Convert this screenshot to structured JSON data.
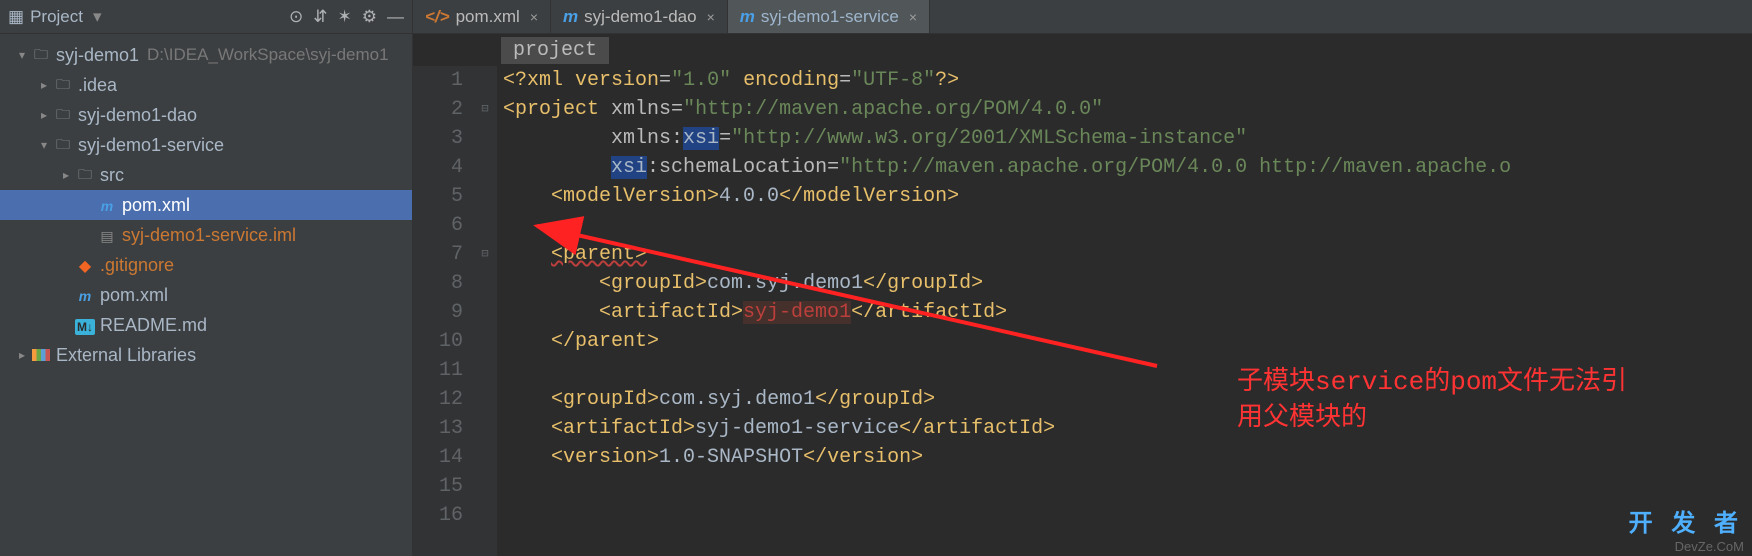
{
  "sidebar": {
    "title": "Project",
    "toolbar_icons": [
      "target-icon",
      "expand-icon",
      "collapse-icon",
      "settings-icon",
      "hide-icon"
    ],
    "tree": [
      {
        "depth": 0,
        "arrow": "expanded",
        "icon": "folder-mod",
        "icon_name": "module-folder-icon",
        "label": "syj-demo1",
        "path": "D:\\IDEA_WorkSpace\\syj-demo1",
        "selected": false
      },
      {
        "depth": 1,
        "arrow": "collapsed",
        "icon": "folder",
        "icon_name": "folder-icon",
        "label": ".idea",
        "selected": false
      },
      {
        "depth": 1,
        "arrow": "collapsed",
        "icon": "folder-mod",
        "icon_name": "module-folder-icon",
        "label": "syj-demo1-dao",
        "selected": false
      },
      {
        "depth": 1,
        "arrow": "expanded",
        "icon": "folder-mod",
        "icon_name": "module-folder-icon",
        "label": "syj-demo1-service",
        "selected": false
      },
      {
        "depth": 2,
        "arrow": "collapsed",
        "icon": "folder",
        "icon_name": "folder-icon",
        "label": "src",
        "selected": false
      },
      {
        "depth": 3,
        "arrow": "none",
        "icon": "maven",
        "icon_name": "maven-file-icon",
        "label": "pom.xml",
        "selected": true
      },
      {
        "depth": 3,
        "arrow": "none",
        "icon": "file",
        "icon_name": "iml-file-icon",
        "label": "syj-demo1-service.iml",
        "warn": true,
        "selected": false
      },
      {
        "depth": 2,
        "arrow": "none",
        "icon": "git",
        "icon_name": "gitignore-icon",
        "label": ".gitignore",
        "warn": true,
        "selected": false
      },
      {
        "depth": 2,
        "arrow": "none",
        "icon": "maven-root",
        "icon_name": "maven-file-icon",
        "label": "pom.xml",
        "selected": false
      },
      {
        "depth": 2,
        "arrow": "none",
        "icon": "md",
        "icon_name": "markdown-icon",
        "label": "README.md",
        "selected": false
      },
      {
        "depth": 0,
        "arrow": "collapsed",
        "icon": "lib",
        "icon_name": "libraries-icon",
        "label": "External Libraries",
        "selected": false
      }
    ]
  },
  "tabs": [
    {
      "icon": "pom",
      "label": "pom.xml",
      "active": false
    },
    {
      "icon": "m",
      "label": "syj-demo1-dao",
      "active": false
    },
    {
      "icon": "m",
      "label": "syj-demo1-service",
      "active": true
    }
  ],
  "breadcrumb": "project",
  "code": {
    "lines": [
      {
        "n": 1,
        "html": "<span class='t-pi'>&lt;?</span><span class='t-tag'>xml version</span><span class='t-attr'>=</span><span class='t-val'>\"1.0\"</span> <span class='t-tag'>encoding</span><span class='t-attr'>=</span><span class='t-val'>\"UTF-8\"</span><span class='t-pi'>?&gt;</span>"
      },
      {
        "n": 2,
        "fold": "-",
        "html": "<span class='t-tag'>&lt;project</span> <span class='t-attr'>xmlns</span><span class='t-attr'>=</span><span class='t-val'>\"http://maven.apache.org/POM/4.0.0\"</span>"
      },
      {
        "n": 3,
        "html": "         <span class='t-attr'>xmlns:</span><span class='t-hl'>xsi</span><span class='t-attr'>=</span><span class='t-val'>\"http://www.w3.org/2001/XMLSchema-instance\"</span>"
      },
      {
        "n": 4,
        "html": "         <span class='t-hl'>xsi</span><span class='t-attr'>:schemaLocation=</span><span class='t-val'>\"http://maven.apache.org/POM/4.0.0 http://maven.apache.o</span>"
      },
      {
        "n": 5,
        "html": "    <span class='t-tag'>&lt;modelVersion&gt;</span><span class='t-text'>4.0.0</span><span class='t-tag'>&lt;/modelVersion&gt;</span>"
      },
      {
        "n": 6,
        "html": ""
      },
      {
        "n": 7,
        "fold": "-",
        "html": "    <span class='t-tag wavy'>&lt;parent&gt;</span>"
      },
      {
        "n": 8,
        "html": "        <span class='t-tag'>&lt;groupId&gt;</span><span class='t-text'>com.syj.demo1</span><span class='t-tag'>&lt;/groupId&gt;</span>"
      },
      {
        "n": 9,
        "html": "        <span class='t-tag'>&lt;artifactId&gt;</span><span class='error-underline'>syj-demo1</span><span class='t-tag'>&lt;/artifactId&gt;</span>"
      },
      {
        "n": 10,
        "html": "    <span class='t-tag'>&lt;/parent&gt;</span>"
      },
      {
        "n": 11,
        "html": ""
      },
      {
        "n": 12,
        "html": "    <span class='t-tag'>&lt;groupId&gt;</span><span class='t-text'>com.syj.demo1</span><span class='t-tag'>&lt;/groupId&gt;</span>"
      },
      {
        "n": 13,
        "html": "    <span class='t-tag'>&lt;artifactId&gt;</span><span class='t-text'>syj-demo1-service</span><span class='t-tag'>&lt;/artifactId&gt;</span>"
      },
      {
        "n": 14,
        "html": "    <span class='t-tag'>&lt;version&gt;</span><span class='t-text'>1.0-SNAPSHOT</span><span class='t-tag'>&lt;/version&gt;</span>"
      },
      {
        "n": 15,
        "html": ""
      },
      {
        "n": 16,
        "html": ""
      }
    ]
  },
  "annotation": {
    "line1": "子模块service的pom文件无法引",
    "line2": "用父模块的"
  },
  "watermark_big": "开 发 者",
  "watermark_small": "DevZe.CoM"
}
